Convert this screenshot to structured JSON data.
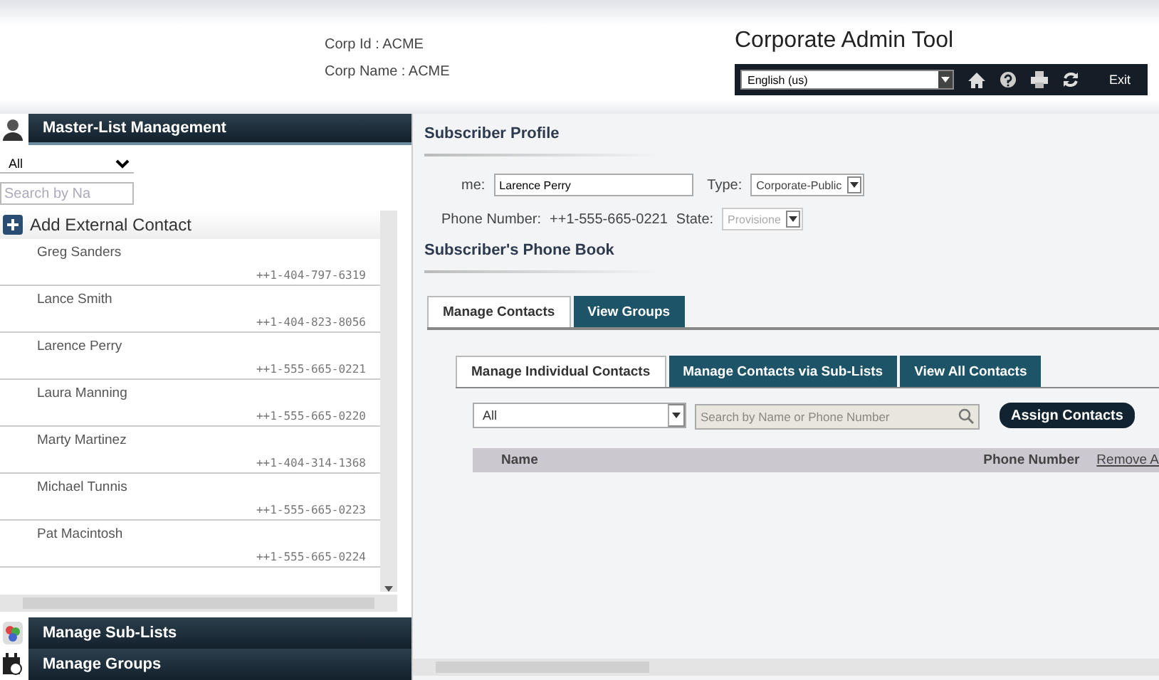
{
  "header": {
    "corp_id": "Corp Id : ACME",
    "corp_name": "Corp Name : ACME",
    "title": "Corporate Admin Tool",
    "language": "English (us)",
    "exit": "Exit"
  },
  "sidebar": {
    "sections": [
      {
        "label": "Master-List Management",
        "expanded": true
      },
      {
        "label": "Manage Sub-Lists",
        "expanded": false
      },
      {
        "label": "Manage Groups",
        "expanded": false
      }
    ],
    "filter": "All",
    "search_placeholder": "Search by Na",
    "add_contact": "Add External Contact",
    "contacts": [
      {
        "name": "Greg Sanders",
        "phone": "++1-404-797-6319"
      },
      {
        "name": "Lance Smith",
        "phone": "++1-404-823-8056"
      },
      {
        "name": "Larence Perry",
        "phone": "++1-555-665-0221"
      },
      {
        "name": "Laura Manning",
        "phone": "++1-555-665-0220"
      },
      {
        "name": "Marty Martinez",
        "phone": "++1-404-314-1368"
      },
      {
        "name": "Michael Tunnis",
        "phone": "++1-555-665-0223"
      },
      {
        "name": "Pat Macintosh",
        "phone": "++1-555-665-0224"
      }
    ]
  },
  "profile": {
    "title": "Subscriber Profile",
    "name_label": "me:",
    "name_value": "Larence Perry",
    "type_label": "Type:",
    "type_value": "Corporate-Public",
    "phone_label": "Phone Number:",
    "phone_value": "++1-555-665-0221",
    "state_label": "State:",
    "state_value": "Provisione",
    "state_disabled": true
  },
  "phone_book": {
    "title": "Subscriber's Phone Book",
    "tabs": [
      {
        "label": "Manage Contacts",
        "selected": true
      },
      {
        "label": "View Groups",
        "selected": false
      }
    ],
    "subtabs": [
      {
        "label": "Manage Individual Contacts",
        "selected": true
      },
      {
        "label": "Manage Contacts via Sub-Lists",
        "selected": false
      },
      {
        "label": "View All Contacts",
        "selected": false
      }
    ],
    "filter": "All",
    "search_placeholder": "Search by Name or Phone Number",
    "assign_button": "Assign Contacts",
    "table": {
      "columns": [
        "Name",
        "Phone Number",
        "Remove A"
      ]
    }
  }
}
